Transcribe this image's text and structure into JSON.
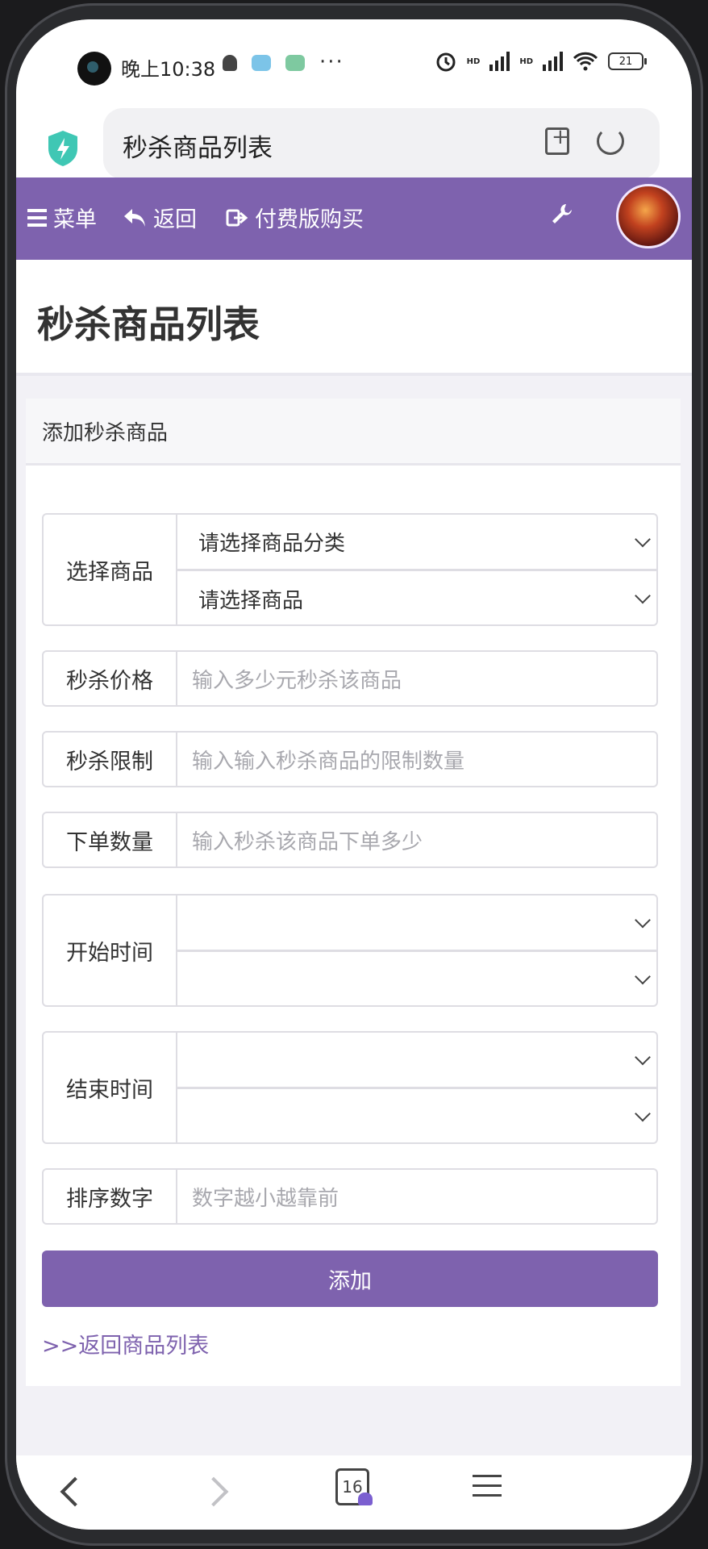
{
  "status_bar": {
    "time": "晚上10:38",
    "more": "···",
    "network1": "HD",
    "network2": "HD",
    "battery": "21"
  },
  "browser": {
    "page_title": "秒杀商品列表"
  },
  "nav": {
    "menu": "菜单",
    "back": "返回",
    "buy": "付费版购买"
  },
  "page": {
    "title": "秒杀商品列表"
  },
  "form": {
    "card_title": "添加秒杀商品",
    "select_product": {
      "label": "选择商品",
      "category_placeholder": "请选择商品分类",
      "product_placeholder": "请选择商品"
    },
    "price": {
      "label": "秒杀价格",
      "placeholder": "输入多少元秒杀该商品"
    },
    "limit": {
      "label": "秒杀限制",
      "placeholder": "输入输入秒杀商品的限制数量"
    },
    "order_qty": {
      "label": "下单数量",
      "placeholder": "输入秒杀该商品下单多少"
    },
    "start_time": {
      "label": "开始时间"
    },
    "end_time": {
      "label": "结束时间"
    },
    "sort": {
      "label": "排序数字",
      "placeholder": "数字越小越靠前"
    },
    "submit": "添加",
    "back_link": ">>返回商品列表"
  },
  "bottom_bar": {
    "tab_count": "16"
  },
  "colors": {
    "accent": "#7e62ae",
    "shield": "#3fc7b4"
  }
}
